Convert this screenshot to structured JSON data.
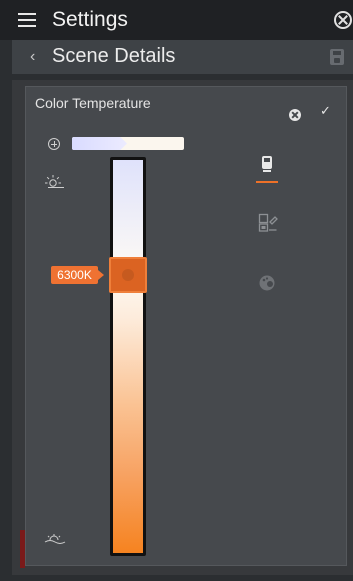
{
  "header": {
    "title": "Settings"
  },
  "subheader": {
    "title": "Scene Details"
  },
  "panel": {
    "title": "Color Temperature"
  },
  "slider": {
    "value_label": "6300K",
    "level_fraction": 0.28
  },
  "icons": {
    "menu": "menu-icon",
    "close_app": "close-circle-icon",
    "back": "chevron-left-icon",
    "save": "save-icon",
    "clear": "clear-icon",
    "confirm": "check-icon",
    "add": "plus-icon",
    "cool": "sun-icon",
    "warm": "sunset-icon",
    "modes": [
      "bulb-mode-icon",
      "scene-mode-icon",
      "palette-mode-icon"
    ]
  },
  "colors": {
    "accent": "#EE7128",
    "thumb": "#DB6322"
  }
}
